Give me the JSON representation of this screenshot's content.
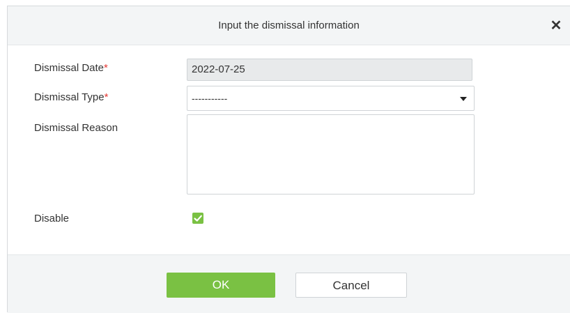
{
  "dialog": {
    "title": "Input the dismissal information",
    "close_icon": "close-icon"
  },
  "form": {
    "dismissal_date": {
      "label": "Dismissal Date",
      "required_mark": "*",
      "value": "2022-07-25"
    },
    "dismissal_type": {
      "label": "Dismissal Type",
      "required_mark": "*",
      "value": "-----------",
      "icon": "caret-down-icon"
    },
    "dismissal_reason": {
      "label": "Dismissal Reason",
      "value": ""
    },
    "disable": {
      "label": "Disable",
      "checked": true,
      "icon": "checkmark-icon"
    }
  },
  "buttons": {
    "ok_label": "OK",
    "cancel_label": "Cancel"
  },
  "colors": {
    "accent": "#7ac143",
    "required": "#e53935",
    "header_bg": "#f3f5f6"
  }
}
